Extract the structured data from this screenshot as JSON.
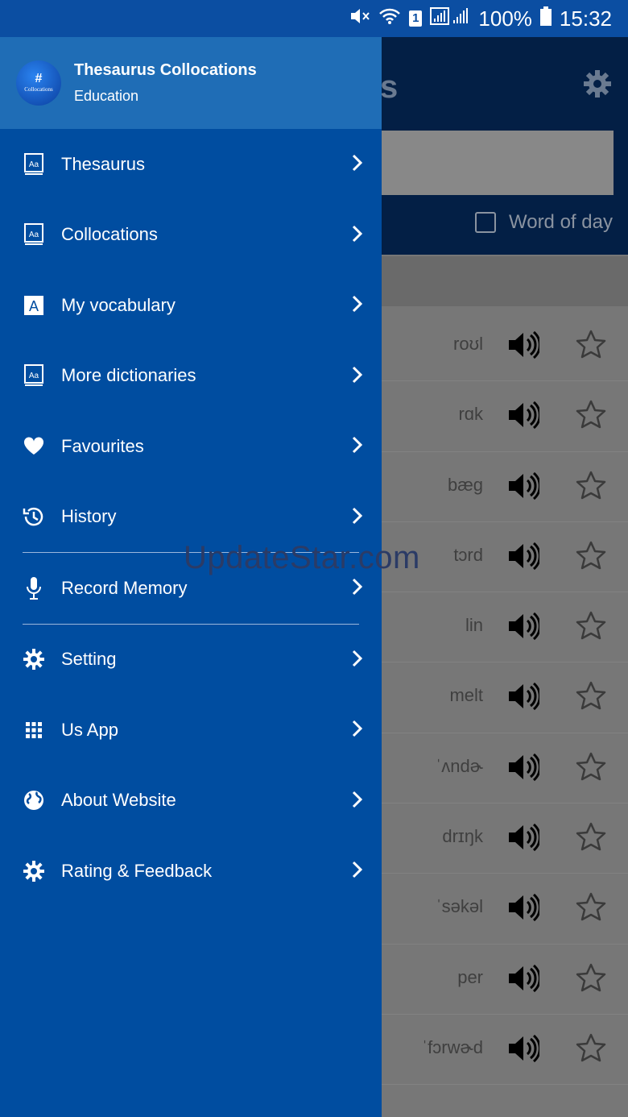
{
  "status_bar": {
    "battery": "100%",
    "time": "15:32",
    "sim_badge": "1",
    "icons": [
      "mute-icon",
      "wifi-icon",
      "signal-icon",
      "battery-icon"
    ]
  },
  "background_screen": {
    "title_fragment": "s",
    "word_of_day_label": "Word of day",
    "rows": [
      {
        "pron": "roʊl"
      },
      {
        "pron": "rɑk"
      },
      {
        "pron": "bæg"
      },
      {
        "pron": "tɔrd"
      },
      {
        "pron": "lin"
      },
      {
        "pron": "melt"
      },
      {
        "pron": "ˈʌndɚ"
      },
      {
        "pron": "drɪŋk"
      },
      {
        "pron": "ˈsəkəl"
      },
      {
        "pron": "per"
      },
      {
        "pron": "ˈfɔrwɚd"
      }
    ]
  },
  "drawer": {
    "app_name": "Thesaurus Collocations",
    "category": "Education",
    "logo_text": "Collocations",
    "logo_symbol": "#",
    "items": [
      {
        "label": "Thesaurus",
        "icon": "book-icon"
      },
      {
        "label": "Collocations",
        "icon": "book-icon"
      },
      {
        "label": "My vocabulary",
        "icon": "letter-a-icon"
      },
      {
        "label": "More dictionaries",
        "icon": "book-icon"
      },
      {
        "label": "Favourites",
        "icon": "heart-icon"
      },
      {
        "label": "History",
        "icon": "history-icon"
      },
      {
        "label": "Record Memory",
        "icon": "microphone-icon"
      },
      {
        "label": "Setting",
        "icon": "gear-icon"
      },
      {
        "label": "Us App",
        "icon": "grid-icon"
      },
      {
        "label": "About Website",
        "icon": "globe-icon"
      },
      {
        "label": "Rating & Feedback",
        "icon": "gear-icon"
      }
    ]
  },
  "watermark": "UpdateStar.com",
  "colors": {
    "drawer_bg": "#004da0",
    "drawer_header": "#1f6db6",
    "status_bar": "#0b4ea2"
  }
}
